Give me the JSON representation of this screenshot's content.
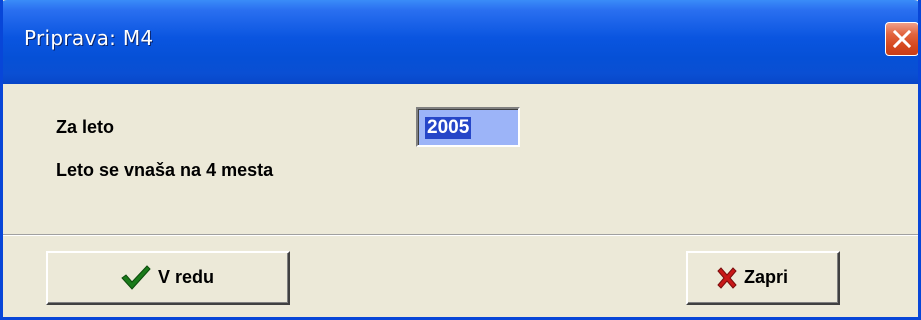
{
  "window": {
    "title": "Priprava: M4",
    "close_icon": "close-icon"
  },
  "form": {
    "year_label": "Za leto",
    "year_value": "2005",
    "hint": "Leto se vnaša na 4 mesta"
  },
  "buttons": {
    "ok_label": "V redu",
    "ok_icon": "checkmark-icon",
    "close_label": "Zapri",
    "close_icon": "red-x-icon"
  },
  "colors": {
    "titlebar": "#0a55e0",
    "dialog_bg": "#ece9d8",
    "selection": "#2646c8",
    "check": "#1a7a1a",
    "x_red": "#c81818"
  }
}
